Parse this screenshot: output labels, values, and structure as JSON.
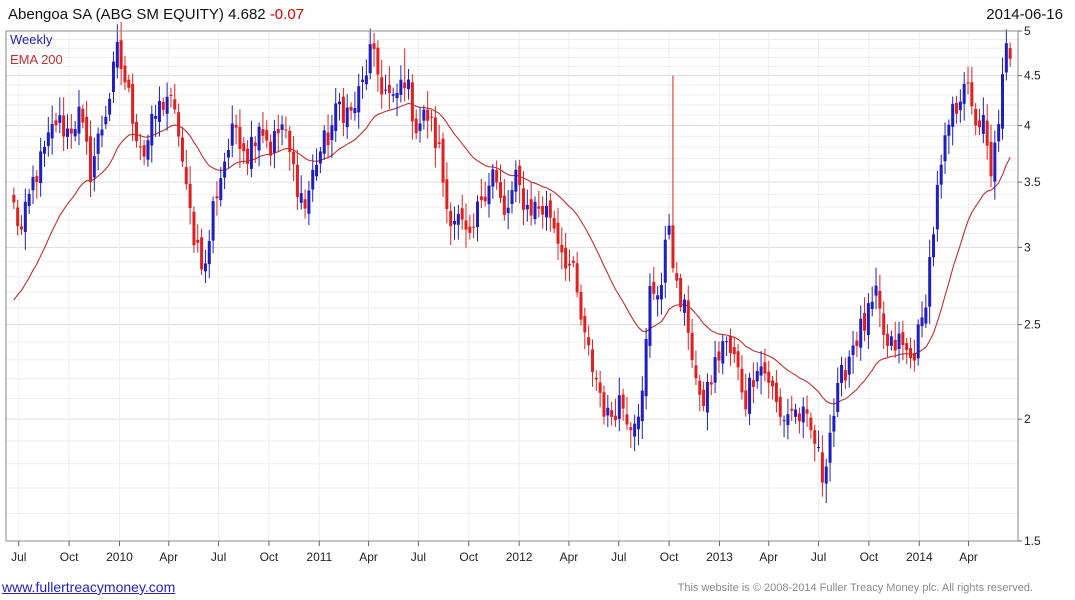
{
  "header": {
    "title": "Abengoa SA (ABG SM EQUITY)",
    "price": "4.682",
    "change": "-0.07",
    "date": "2014-06-16"
  },
  "legend": {
    "weekly": "Weekly",
    "ema": "EMA 200"
  },
  "footer": {
    "url": "www.fullertreacymoney.com",
    "copyright": "This website is © 2008-2014 Fuller Treacy Money plc. All rights reserved."
  },
  "colors": {
    "up": "#1f1fc0",
    "down": "#e02020",
    "ema": "#c03030",
    "grid": "#dcdcdc",
    "grid_minor": "#eeeeee"
  },
  "chart_data": {
    "type": "candlestick",
    "frequency": "weekly",
    "y_scale": "log",
    "ylim": [
      1.5,
      5
    ],
    "yticks": [
      1.5,
      2,
      2.5,
      3,
      3.5,
      4,
      4.5,
      5
    ],
    "ytick_labels": [
      "1.5",
      "2",
      "2.5",
      "3",
      "3.5",
      "4",
      "4.5",
      "5"
    ],
    "x_tick_labels": [
      "Jul",
      "Oct",
      "2010",
      "Apr",
      "Jul",
      "Oct",
      "2011",
      "Apr",
      "Jul",
      "Oct",
      "2012",
      "Apr",
      "Jul",
      "Oct",
      "2013",
      "Apr",
      "Jul",
      "Oct",
      "2014",
      "Apr"
    ],
    "close_anchors": [
      [
        "2009-06-22",
        3.3
      ],
      [
        "2009-07-06",
        3.1
      ],
      [
        "2009-07-27",
        3.5
      ],
      [
        "2009-08-17",
        3.75
      ],
      [
        "2009-09-07",
        4.05
      ],
      [
        "2009-09-28",
        3.95
      ],
      [
        "2009-10-19",
        4.1
      ],
      [
        "2009-11-09",
        3.6
      ],
      [
        "2009-11-30",
        4.0
      ],
      [
        "2009-12-14",
        4.3
      ],
      [
        "2009-12-28",
        4.75
      ],
      [
        "2010-01-11",
        4.45
      ],
      [
        "2010-02-01",
        3.95
      ],
      [
        "2010-02-15",
        3.75
      ],
      [
        "2010-03-08",
        4.1
      ],
      [
        "2010-03-29",
        4.3
      ],
      [
        "2010-04-19",
        3.95
      ],
      [
        "2010-05-03",
        3.4
      ],
      [
        "2010-05-17",
        3.1
      ],
      [
        "2010-06-07",
        2.85
      ],
      [
        "2010-06-21",
        3.3
      ],
      [
        "2010-07-12",
        3.7
      ],
      [
        "2010-08-02",
        4.0
      ],
      [
        "2010-08-23",
        3.75
      ],
      [
        "2010-09-13",
        4.05
      ],
      [
        "2010-10-04",
        3.8
      ],
      [
        "2010-10-25",
        4.0
      ],
      [
        "2010-11-15",
        3.6
      ],
      [
        "2010-12-06",
        3.3
      ],
      [
        "2010-12-27",
        3.7
      ],
      [
        "2011-01-17",
        3.9
      ],
      [
        "2011-02-07",
        4.2
      ],
      [
        "2011-02-28",
        4.1
      ],
      [
        "2011-03-21",
        4.4
      ],
      [
        "2011-04-04",
        4.75
      ],
      [
        "2011-04-25",
        4.4
      ],
      [
        "2011-05-16",
        4.2
      ],
      [
        "2011-06-06",
        4.5
      ],
      [
        "2011-06-27",
        4.0
      ],
      [
        "2011-07-18",
        4.1
      ],
      [
        "2011-08-08",
        3.75
      ],
      [
        "2011-08-22",
        3.3
      ],
      [
        "2011-09-12",
        3.2
      ],
      [
        "2011-10-03",
        3.0
      ],
      [
        "2011-10-24",
        3.4
      ],
      [
        "2011-11-14",
        3.6
      ],
      [
        "2011-12-05",
        3.2
      ],
      [
        "2011-12-26",
        3.5
      ],
      [
        "2012-01-16",
        3.3
      ],
      [
        "2012-02-06",
        3.3
      ],
      [
        "2012-02-27",
        3.25
      ],
      [
        "2012-03-19",
        3.0
      ],
      [
        "2012-04-09",
        2.8
      ],
      [
        "2012-04-30",
        2.4
      ],
      [
        "2012-05-21",
        2.2
      ],
      [
        "2012-06-11",
        2.0
      ],
      [
        "2012-07-02",
        2.1
      ],
      [
        "2012-07-23",
        2.0
      ],
      [
        "2012-08-13",
        2.1
      ],
      [
        "2012-08-27",
        2.7
      ],
      [
        "2012-09-17",
        2.75
      ],
      [
        "2012-10-01",
        3.2
      ],
      [
        "2012-10-15",
        2.7
      ],
      [
        "2012-11-05",
        2.5
      ],
      [
        "2012-11-26",
        2.05
      ],
      [
        "2012-12-17",
        2.2
      ],
      [
        "2013-01-07",
        2.4
      ],
      [
        "2013-01-28",
        2.3
      ],
      [
        "2013-02-18",
        2.1
      ],
      [
        "2013-03-11",
        2.3
      ],
      [
        "2013-04-01",
        2.2
      ],
      [
        "2013-04-22",
        2.0
      ],
      [
        "2013-05-13",
        2.05
      ],
      [
        "2013-06-03",
        2.0
      ],
      [
        "2013-06-24",
        1.9
      ],
      [
        "2013-07-08",
        1.75
      ],
      [
        "2013-07-22",
        1.95
      ],
      [
        "2013-08-12",
        2.2
      ],
      [
        "2013-09-02",
        2.4
      ],
      [
        "2013-09-23",
        2.5
      ],
      [
        "2013-10-14",
        2.65
      ],
      [
        "2013-11-04",
        2.35
      ],
      [
        "2013-11-25",
        2.4
      ],
      [
        "2013-12-16",
        2.3
      ],
      [
        "2014-01-06",
        2.5
      ],
      [
        "2014-01-20",
        2.9
      ],
      [
        "2014-02-03",
        3.4
      ],
      [
        "2014-02-24",
        4.0
      ],
      [
        "2014-03-10",
        4.2
      ],
      [
        "2014-03-24",
        4.5
      ],
      [
        "2014-04-07",
        4.1
      ],
      [
        "2014-04-28",
        4.0
      ],
      [
        "2014-05-12",
        3.5
      ],
      [
        "2014-05-26",
        4.1
      ],
      [
        "2014-06-09",
        4.75
      ],
      [
        "2014-06-16",
        4.682
      ]
    ],
    "high_spikes": [
      [
        "2012-10-08",
        4.5
      ],
      [
        "2011-06-06",
        4.8
      ],
      [
        "2010-01-04",
        4.85
      ]
    ],
    "last_close": 4.682,
    "last_change": -0.07,
    "series": [
      {
        "name": "Weekly",
        "kind": "candlestick"
      },
      {
        "name": "EMA 200",
        "kind": "line"
      }
    ],
    "grid": true,
    "legend_position": "top-left"
  }
}
